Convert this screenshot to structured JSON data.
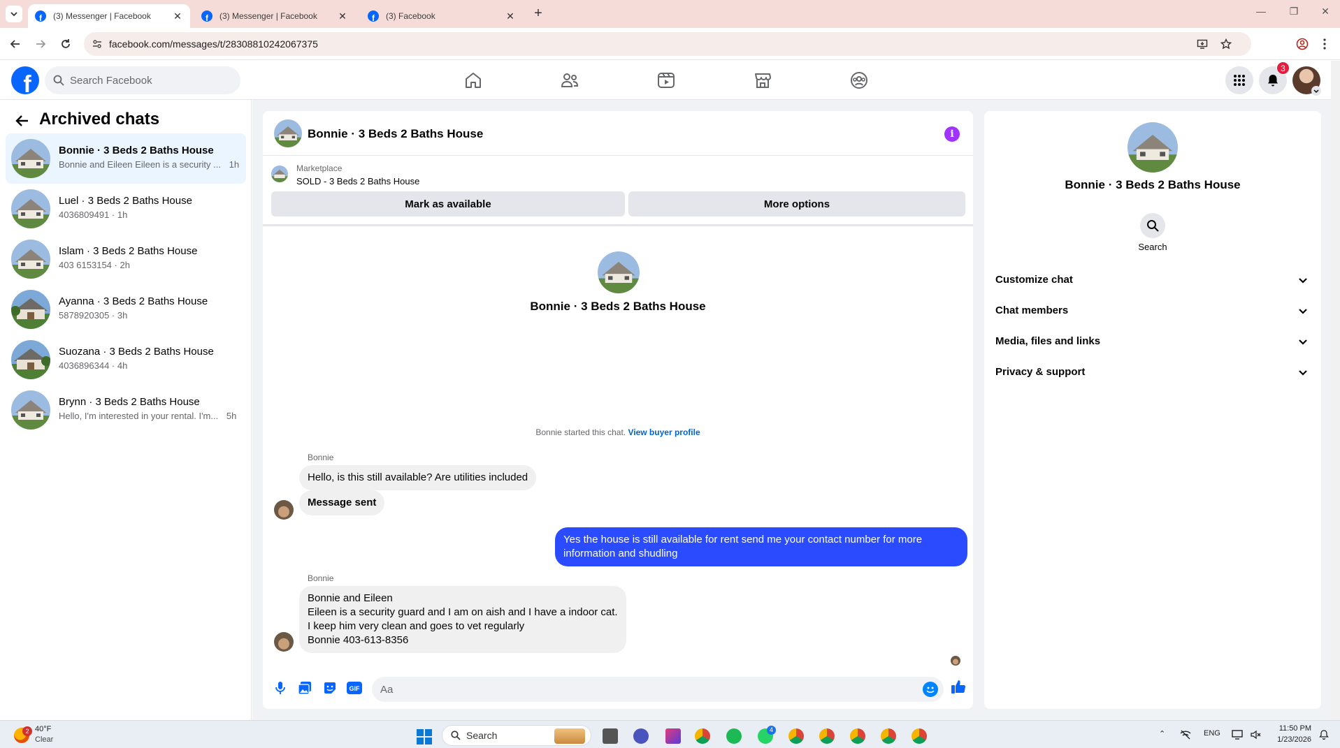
{
  "browser": {
    "tabs": [
      {
        "title": "(3) Messenger | Facebook",
        "active": true
      },
      {
        "title": "(3) Messenger | Facebook",
        "active": false
      },
      {
        "title": "(3) Facebook",
        "active": false
      }
    ],
    "url": "facebook.com/messages/t/28308810242067375"
  },
  "header": {
    "search_placeholder": "Search Facebook",
    "notification_count": "3",
    "nav_icons": [
      "home-icon",
      "friends-icon",
      "video-icon",
      "marketplace-icon",
      "groups-icon"
    ]
  },
  "sidebar": {
    "title": "Archived chats",
    "chats": [
      {
        "name": "Bonnie · 3 Beds 2 Baths House",
        "preview": "Bonnie and Eileen Eileen is a security ...",
        "time": "1h"
      },
      {
        "name": "Luel · 3 Beds 2 Baths House",
        "preview": "4036809491 · 1h"
      },
      {
        "name": "Islam · 3 Beds 2 Baths House",
        "preview": "403 6153154 · 2h"
      },
      {
        "name": "Ayanna · 3 Beds 2 Baths House",
        "preview": "5878920305 · 3h"
      },
      {
        "name": "Suozana · 3 Beds 2 Baths House",
        "preview": "4036896344 · 4h"
      },
      {
        "name": "Brynn · 3 Beds 2 Baths House",
        "preview": "Hello, I'm interested in your rental. I'm...",
        "time": "5h"
      }
    ]
  },
  "conversation": {
    "title": "Bonnie · 3 Beds 2 Baths House",
    "marketplace_label": "Marketplace",
    "listing": "SOLD - 3 Beds 2 Baths House",
    "mark_available": "Mark as available",
    "more_options": "More options",
    "started_text": "Bonnie started this chat.",
    "buyer_profile_link": "View buyer profile",
    "sender_name": "Bonnie",
    "messages": {
      "m1": "Hello, is this still available? Are utilities included",
      "m2": "Message sent",
      "m3": "Yes the house is still available for rent send me your contact number for more information and shudling",
      "m4_line1": "Bonnie and Eileen",
      "m4_line2": "Eileen is a security guard and I am on aish and I have a indoor cat.",
      "m4_line3": "I keep him very clean and goes to vet regularly",
      "m4_line4": "Bonnie 403-613-8356"
    },
    "composer_placeholder": "Aa",
    "accent_color": "#2a4bff"
  },
  "details": {
    "name": "Bonnie · 3 Beds 2 Baths House",
    "search_label": "Search",
    "sections": [
      "Customize chat",
      "Chat members",
      "Media, files and links",
      "Privacy & support"
    ]
  },
  "taskbar": {
    "weather_badge": "2",
    "temperature": "40°F",
    "condition": "Clear",
    "search_label": "Search",
    "whatsapp_badge": "4",
    "language": "ENG",
    "time": "11:50 PM",
    "date": "1/23/2026"
  }
}
